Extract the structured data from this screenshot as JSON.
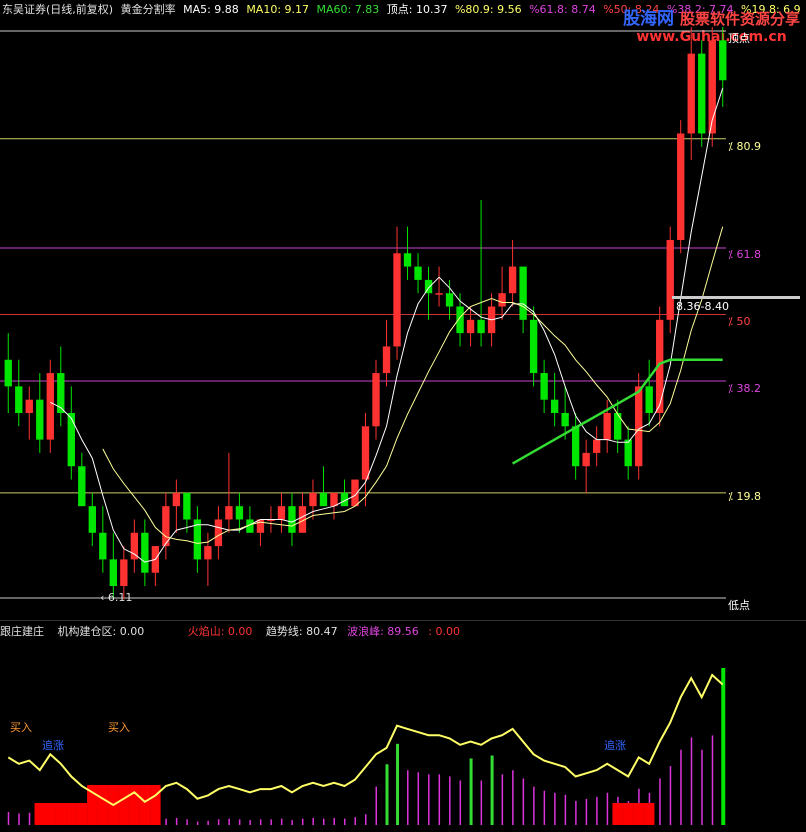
{
  "header": {
    "title": "东吴证券(日线,前复权)",
    "indicator": "黄金分割率",
    "ma5": "MA5: 9.88",
    "ma10": "MA10: 9.17",
    "ma60": "MA60: 7.83",
    "top": "顶点: 10.37",
    "p809": "%80.9: 9.56",
    "p618": "%61.8: 8.74",
    "p50": "%50: 8.24",
    "p382": "%38.2: 7.74",
    "p198": "%19.8: 6.9"
  },
  "watermark": {
    "logo": "股海网",
    "slogan": "股票软件资源分享",
    "url": "www.Guhai.com.cn"
  },
  "levels": {
    "top": "顶点",
    "l809": "80.9",
    "l618": "61.8",
    "l50": "50",
    "l382": "38.2",
    "l198": "19.8",
    "bottom": "低点"
  },
  "annotations": {
    "low_price": "6.11",
    "range_tag": "8.36-8.40"
  },
  "sub": {
    "name": "跟庄建庄",
    "build": "机构建仓区: 0.00",
    "volcano": "火焰山: 0.00",
    "trend": "趋势线: 80.47",
    "wave": "波浪峰: 89.56",
    "extra": ": 0.00",
    "buy1": "买入",
    "buy2": "买入",
    "chase1": "追涨",
    "chase2": "追涨"
  },
  "colors": {
    "up": "#ff3232",
    "down": "#00e600",
    "ma5": "#ffffff",
    "ma10": "#ffff99",
    "ma60": "#33dd33",
    "fib_yellow": "#cccc66",
    "fib_magenta": "#cc44cc",
    "fib_red": "#cc3333",
    "trend": "#ffff66",
    "wave": "#dd33dd",
    "build": "#ff0000"
  },
  "chart_data": {
    "type": "candlestick",
    "y_range": [
      6.0,
      10.5
    ],
    "fib_levels": {
      "top": 10.37,
      "80.9": 9.56,
      "61.8": 8.74,
      "50": 8.24,
      "38.2": 7.74,
      "19.8": 6.9,
      "low": 6.11
    },
    "candles": [
      [
        7.9,
        8.1,
        7.5,
        7.7
      ],
      [
        7.7,
        7.9,
        7.4,
        7.5
      ],
      [
        7.5,
        7.7,
        7.3,
        7.6
      ],
      [
        7.6,
        7.8,
        7.2,
        7.3
      ],
      [
        7.3,
        7.9,
        7.2,
        7.8
      ],
      [
        7.8,
        8.0,
        7.4,
        7.5
      ],
      [
        7.5,
        7.7,
        7.0,
        7.1
      ],
      [
        7.1,
        7.2,
        6.8,
        6.8
      ],
      [
        6.8,
        6.9,
        6.5,
        6.6
      ],
      [
        6.6,
        6.8,
        6.3,
        6.4
      ],
      [
        6.4,
        6.6,
        6.1,
        6.2
      ],
      [
        6.2,
        6.5,
        6.1,
        6.4
      ],
      [
        6.4,
        6.7,
        6.3,
        6.6
      ],
      [
        6.6,
        6.7,
        6.2,
        6.3
      ],
      [
        6.3,
        6.5,
        6.2,
        6.5
      ],
      [
        6.5,
        6.9,
        6.4,
        6.8
      ],
      [
        6.8,
        7.0,
        6.6,
        6.9
      ],
      [
        6.9,
        6.9,
        6.6,
        6.7
      ],
      [
        6.7,
        6.8,
        6.3,
        6.4
      ],
      [
        6.4,
        6.6,
        6.2,
        6.5
      ],
      [
        6.5,
        6.8,
        6.4,
        6.7
      ],
      [
        6.7,
        7.2,
        6.6,
        6.8
      ],
      [
        6.8,
        6.9,
        6.6,
        6.7
      ],
      [
        6.7,
        6.8,
        6.6,
        6.6
      ],
      [
        6.6,
        6.7,
        6.5,
        6.7
      ],
      [
        6.7,
        6.8,
        6.6,
        6.7
      ],
      [
        6.7,
        6.9,
        6.6,
        6.8
      ],
      [
        6.8,
        6.9,
        6.5,
        6.6
      ],
      [
        6.6,
        6.9,
        6.6,
        6.8
      ],
      [
        6.8,
        7.0,
        6.7,
        6.9
      ],
      [
        6.9,
        7.1,
        6.8,
        6.8
      ],
      [
        6.8,
        6.9,
        6.7,
        6.9
      ],
      [
        6.9,
        7.0,
        6.8,
        6.8
      ],
      [
        6.8,
        7.0,
        6.8,
        7.0
      ],
      [
        7.0,
        7.5,
        6.8,
        7.4
      ],
      [
        7.4,
        7.9,
        7.3,
        7.8
      ],
      [
        7.8,
        8.2,
        7.7,
        8.0
      ],
      [
        8.0,
        8.9,
        7.9,
        8.7
      ],
      [
        8.7,
        8.9,
        8.5,
        8.6
      ],
      [
        8.6,
        8.7,
        8.4,
        8.5
      ],
      [
        8.5,
        8.6,
        8.2,
        8.4
      ],
      [
        8.4,
        8.6,
        8.3,
        8.4
      ],
      [
        8.4,
        8.5,
        8.2,
        8.3
      ],
      [
        8.3,
        8.4,
        8.0,
        8.1
      ],
      [
        8.1,
        8.3,
        8.0,
        8.2
      ],
      [
        8.2,
        9.1,
        8.0,
        8.1
      ],
      [
        8.1,
        8.4,
        8.0,
        8.3
      ],
      [
        8.3,
        8.6,
        8.2,
        8.4
      ],
      [
        8.4,
        8.8,
        8.3,
        8.6
      ],
      [
        8.6,
        8.6,
        8.1,
        8.2
      ],
      [
        8.2,
        8.3,
        7.7,
        7.8
      ],
      [
        7.8,
        7.9,
        7.5,
        7.6
      ],
      [
        7.6,
        7.8,
        7.4,
        7.5
      ],
      [
        7.5,
        7.7,
        7.3,
        7.4
      ],
      [
        7.4,
        7.5,
        7.0,
        7.1
      ],
      [
        7.1,
        7.3,
        6.9,
        7.2
      ],
      [
        7.2,
        7.4,
        7.1,
        7.3
      ],
      [
        7.3,
        7.6,
        7.2,
        7.5
      ],
      [
        7.5,
        7.6,
        7.2,
        7.3
      ],
      [
        7.3,
        7.4,
        7.0,
        7.1
      ],
      [
        7.1,
        7.8,
        7.0,
        7.7
      ],
      [
        7.7,
        7.9,
        7.4,
        7.5
      ],
      [
        7.5,
        8.3,
        7.4,
        8.2
      ],
      [
        8.2,
        8.9,
        8.1,
        8.8
      ],
      [
        8.8,
        9.7,
        8.7,
        9.6
      ],
      [
        9.6,
        10.4,
        9.4,
        10.2
      ],
      [
        10.2,
        10.3,
        9.5,
        9.6
      ],
      [
        9.6,
        10.4,
        9.5,
        10.3
      ],
      [
        10.3,
        10.4,
        9.8,
        10.0
      ]
    ]
  }
}
